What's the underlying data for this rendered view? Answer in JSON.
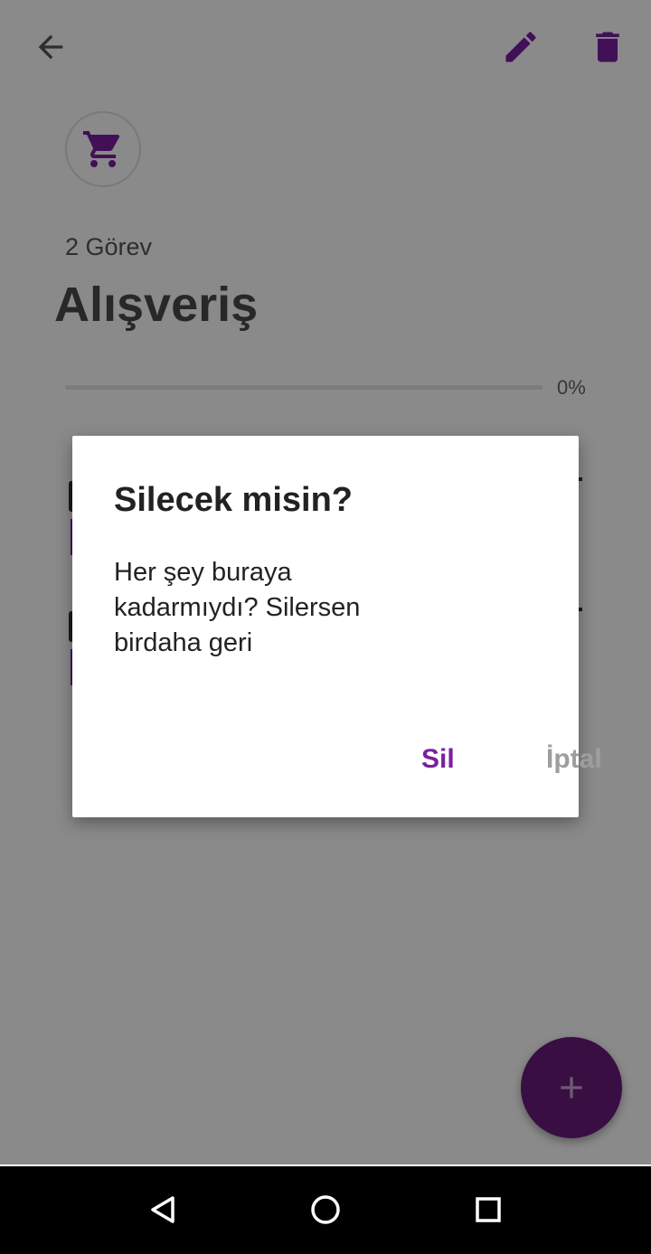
{
  "header": {
    "back_icon": "arrow-back-icon",
    "edit_icon": "pencil-icon",
    "delete_icon": "trash-icon"
  },
  "category": {
    "icon": "shopping-cart-icon",
    "color": "#7b1fa2"
  },
  "list": {
    "task_count": "2 Görev",
    "title": "Alışveriş",
    "progress": 0,
    "progress_label": "0%"
  },
  "dialog": {
    "title": "Silecek misin?",
    "body": "Her şey buraya kadarmıydı? Silersen birdaha geri",
    "confirm_label": "Sil",
    "cancel_label": "İptal"
  },
  "fab": {
    "icon": "plus-icon"
  },
  "nav": {
    "back_icon": "nav-back-icon",
    "home_icon": "nav-home-icon",
    "recents_icon": "nav-recents-icon"
  },
  "colors": {
    "accent": "#7b1fa2",
    "fab": "#6a1b7a"
  }
}
